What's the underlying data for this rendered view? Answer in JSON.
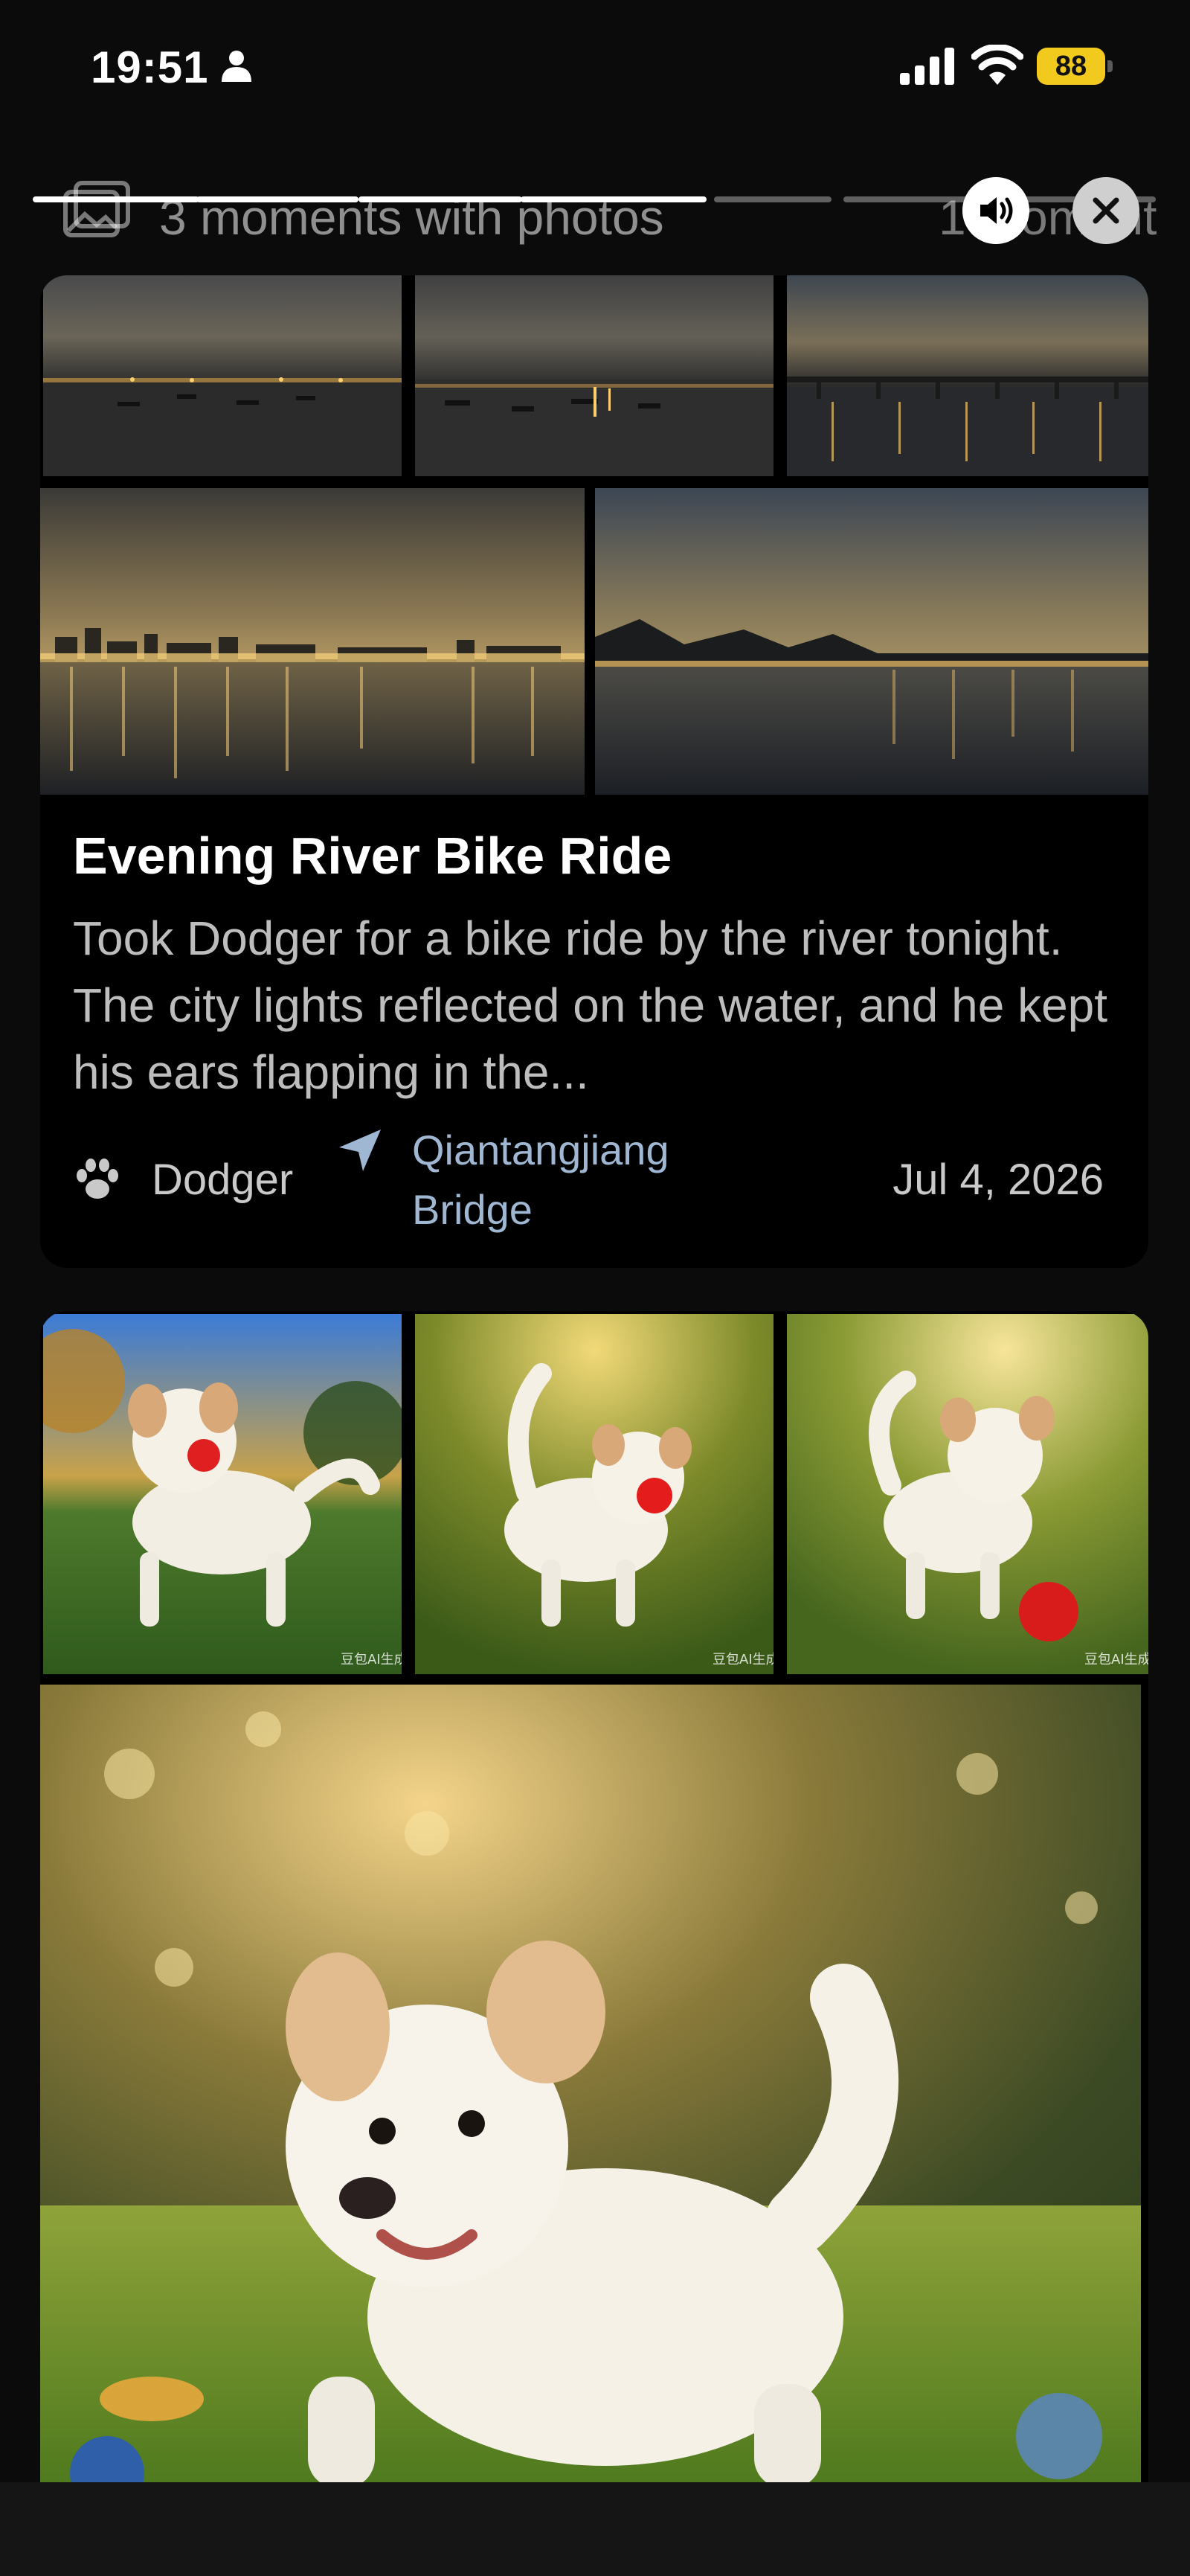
{
  "status_bar": {
    "time": "19:51",
    "battery_level": "88",
    "colors": {
      "battery": "#f2c91d"
    },
    "icons": [
      "person-icon",
      "signal-icon",
      "wifi-icon",
      "battery-icon"
    ]
  },
  "story": {
    "title": "3 moments with photos",
    "count_label": "1 moment",
    "segments": [
      {
        "state": "done"
      },
      {
        "state": "done"
      },
      {
        "state": "done"
      },
      {
        "state": "done"
      },
      {
        "state": "pending"
      },
      {
        "state": "pending"
      }
    ],
    "icons": {
      "header": "photos-icon",
      "sound": "speaker-icon",
      "close": "close-icon"
    }
  },
  "moments": [
    {
      "title": "Evening River Bike Ride",
      "description": "Took Dodger for a bike ride by the river tonight. The city lights reflected on the water, and he kept his ears flapping in the...",
      "pet": "Dodger",
      "location": "Qiantangjiang Bridge",
      "date": "Jul 4, 2026",
      "colors": {
        "location": "#9fb7d2"
      },
      "photos": [
        {
          "subject": "river-harbor-dusk-photo"
        },
        {
          "subject": "river-boats-dusk-photo"
        },
        {
          "subject": "bridge-night-photo"
        },
        {
          "subject": "city-skyline-reflection-photo"
        },
        {
          "subject": "mountain-river-dusk-photo"
        }
      ]
    },
    {
      "photos": [
        {
          "subject": "puppy-with-ball-photo",
          "watermark": "豆包AI生成"
        },
        {
          "subject": "puppy-running-grass-photo",
          "watermark": "豆包AI生成"
        },
        {
          "subject": "puppy-red-ball-photo",
          "watermark": "豆包AI生成"
        },
        {
          "subject": "puppy-running-large-photo"
        }
      ]
    }
  ]
}
